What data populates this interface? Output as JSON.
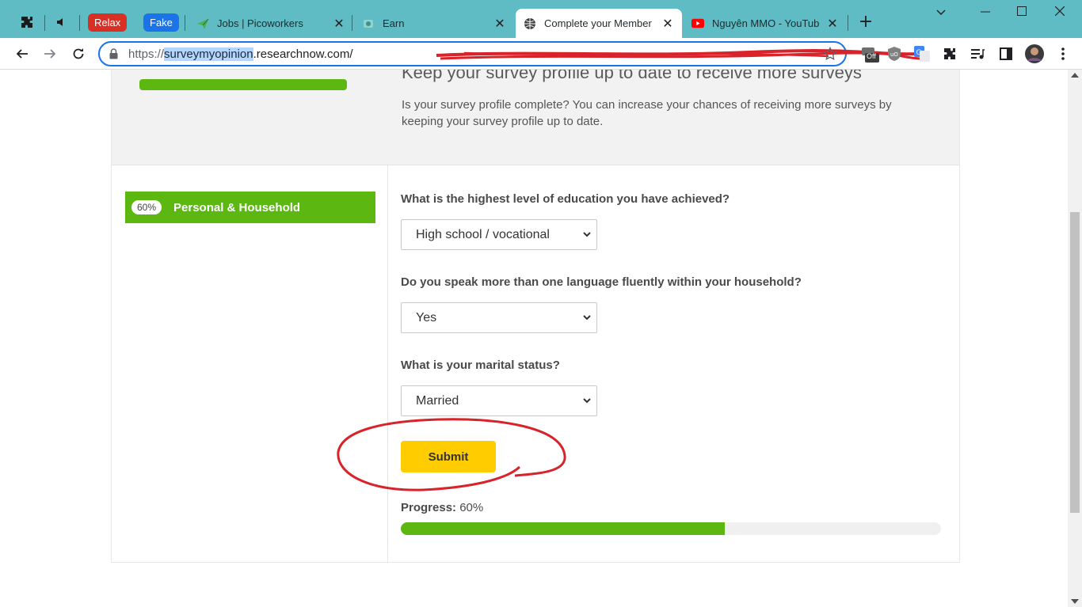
{
  "browser": {
    "groups": [
      {
        "label": "Relax",
        "color": "#d93025"
      },
      {
        "label": "Fake",
        "color": "#1a73e8"
      }
    ],
    "tabs": [
      {
        "title": "Jobs | Picoworkers"
      },
      {
        "title": "Earn"
      },
      {
        "title": "Complete your Member",
        "active": true
      },
      {
        "title": "Nguyên MMO - YouTub"
      }
    ],
    "url": {
      "scheme": "https://",
      "selected": "surveymyopinion",
      "rest": ".researchnow.com/"
    },
    "extension_badge": "Off"
  },
  "profile_banner": {
    "heading": "Keep your survey profile up to date to receive more surveys",
    "text": "Is your survey profile complete? You can increase your chances of receiving more surveys by keeping your survey profile up to date."
  },
  "section": {
    "percent": "60%",
    "label": "Personal & Household"
  },
  "questions": [
    {
      "text": "What is the highest level of education you have achieved?",
      "value": "High school / vocational"
    },
    {
      "text": "Do you speak more than one language fluently within your household?",
      "value": "Yes"
    },
    {
      "text": "What is your marital status?",
      "value": "Married"
    }
  ],
  "submit_label": "Submit",
  "progress": {
    "label": "Progress:",
    "value_text": "60%",
    "fraction": 0.6
  },
  "colors": {
    "accent_green": "#5cb811",
    "submit_yellow": "#ffcc00",
    "annotation_red": "#d9232a"
  }
}
